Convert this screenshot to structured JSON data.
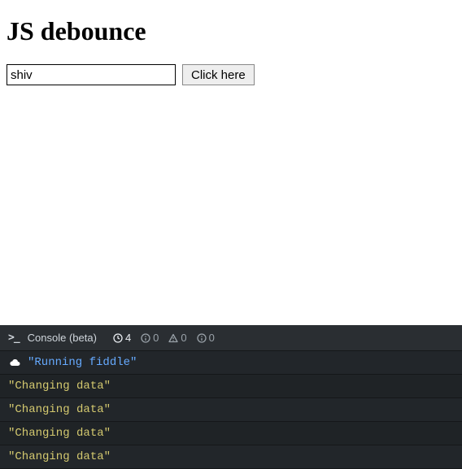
{
  "heading": "JS debounce",
  "input": {
    "value": "shiv",
    "placeholder": ""
  },
  "button": {
    "label": "Click here"
  },
  "console": {
    "title": "Console (beta)",
    "stats": {
      "log_count": "4",
      "info_count": "0",
      "warn_count": "0",
      "error_count": "0"
    },
    "logs": [
      {
        "text": "\"Running fiddle\"",
        "color": "blue",
        "cloud": true
      },
      {
        "text": "\"Changing data\"",
        "color": "yellow",
        "cloud": false
      },
      {
        "text": "\"Changing data\"",
        "color": "yellow",
        "cloud": false
      },
      {
        "text": "\"Changing data\"",
        "color": "yellow",
        "cloud": false
      },
      {
        "text": "\"Changing data\"",
        "color": "yellow",
        "cloud": false
      }
    ]
  }
}
